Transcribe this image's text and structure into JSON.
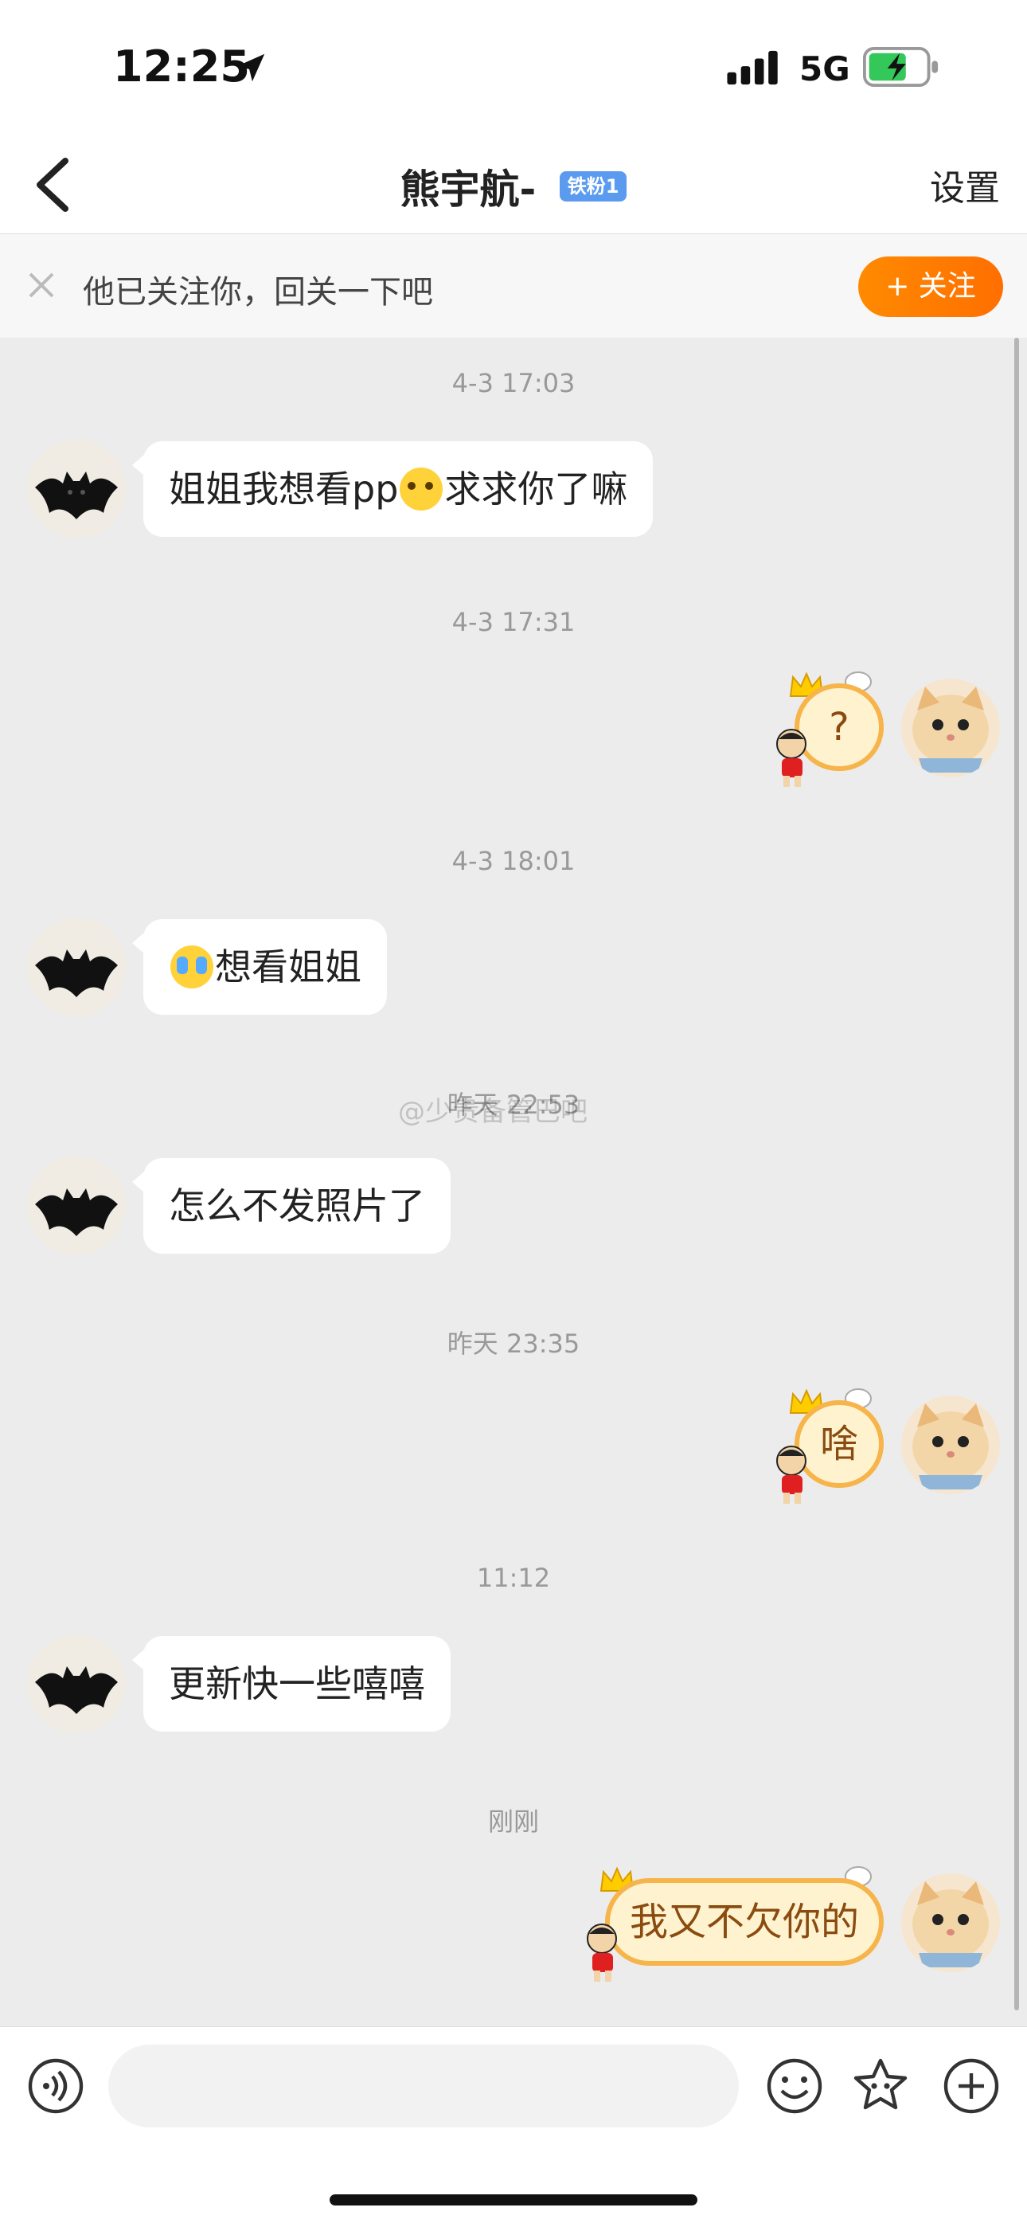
{
  "status_bar": {
    "time": "12:25",
    "network": "5G"
  },
  "nav": {
    "title": "熊宇航-",
    "badge": "铁粉1",
    "settings": "设置"
  },
  "follow_bar": {
    "text": "他已关注你，回关一下吧",
    "button": "+ 关注"
  },
  "messages": [
    {
      "time": "4-3 17:03",
      "from": "other",
      "text_before": "姐姐我想看pp",
      "emoji": "pleading-face",
      "text_after": "求求你了嘛"
    },
    {
      "time": "4-3 17:31",
      "from": "me",
      "text": "?"
    },
    {
      "time": "4-3 18:01",
      "from": "other",
      "emoji": "crying-face",
      "text": "想看姐姐"
    },
    {
      "time": "昨天 22:53",
      "from": "other",
      "text": "怎么不发照片了"
    },
    {
      "time": "昨天 23:35",
      "from": "me",
      "text": "啥"
    },
    {
      "time": "11:12",
      "from": "other",
      "text": "更新快一些嘻嘻"
    },
    {
      "time": "刚刚",
      "from": "me",
      "text": "我又不欠你的"
    }
  ],
  "watermark": "@少贵备管巴吧",
  "input": {
    "placeholder": ""
  },
  "colors": {
    "accent": "#ff7a00",
    "sticker_border": "#f6b44a",
    "badge": "#5a9bf0"
  }
}
